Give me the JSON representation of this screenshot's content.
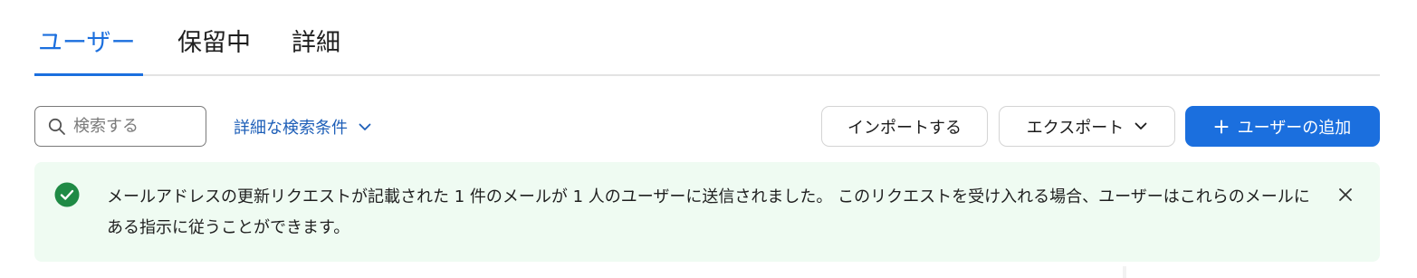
{
  "tabs": [
    {
      "label": "ユーザー",
      "active": true
    },
    {
      "label": "保留中",
      "active": false
    },
    {
      "label": "詳細",
      "active": false
    }
  ],
  "toolbar": {
    "search_placeholder": "検索する",
    "advanced_filter_label": "詳細な検索条件",
    "import_label": "インポートする",
    "export_label": "エクスポート",
    "add_user_label": "ユーザーの追加"
  },
  "banner": {
    "message": "メールアドレスの更新リクエストが記載された 1 件のメールが 1 人のユーザーに送信されました。 このリクエストを受け入れる場合、ユーザーはこれらのメールにある指示に従うことができます。",
    "status": "success"
  },
  "colors": {
    "accent": "#1b6fde",
    "link": "#1e5fb8",
    "success_bg": "#effbf2",
    "success_icon": "#1f8a45"
  },
  "icons": [
    "search-icon",
    "chevron-down-icon",
    "plus-icon",
    "check-circle-icon",
    "close-icon"
  ]
}
